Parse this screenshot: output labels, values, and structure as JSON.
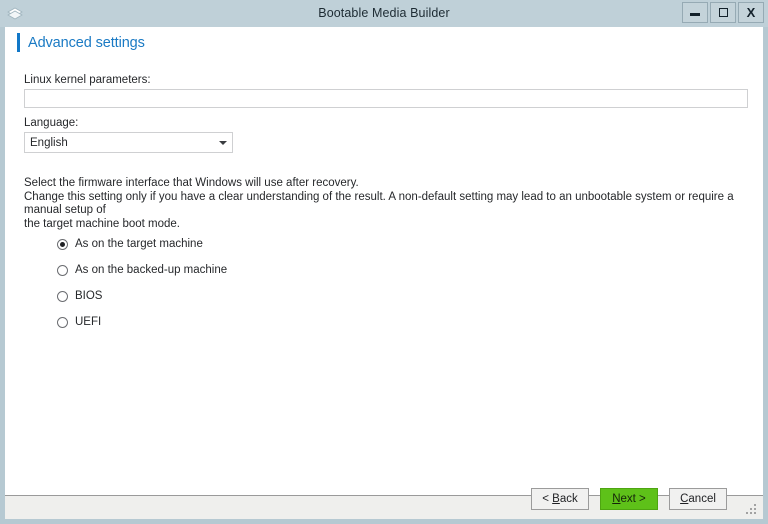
{
  "window": {
    "title": "Bootable Media Builder",
    "icon": "acronis-diamond-icon",
    "controls": {
      "minimize": "minimize-icon",
      "maximize": "maximize-icon",
      "close": "X"
    }
  },
  "page": {
    "title": "Advanced settings",
    "accent_color": "#1278c8"
  },
  "fields": {
    "kernel": {
      "label": "Linux kernel parameters:",
      "value": "",
      "placeholder": ""
    },
    "language": {
      "label": "Language:",
      "value": "English",
      "options": [
        "English"
      ]
    }
  },
  "description": {
    "line1": "Select the firmware interface that Windows will use after recovery.",
    "line2": "Change this setting only if you have a clear understanding of the result. A non-default setting may lead to an unbootable system or require a manual setup of",
    "line3": "the target machine boot mode."
  },
  "firmware_options": [
    {
      "label": "As on the target machine",
      "checked": true
    },
    {
      "label": "As on the backed-up machine",
      "checked": false
    },
    {
      "label": "BIOS",
      "checked": false
    },
    {
      "label": "UEFI",
      "checked": false
    }
  ],
  "footer": {
    "back": {
      "prefix": "< ",
      "mnemonic": "B",
      "suffix": "ack"
    },
    "next": {
      "prefix": "",
      "mnemonic": "N",
      "suffix": "ext >"
    },
    "cancel": {
      "prefix": "",
      "mnemonic": "C",
      "suffix": "ancel"
    },
    "next_color": "#5ec119"
  }
}
